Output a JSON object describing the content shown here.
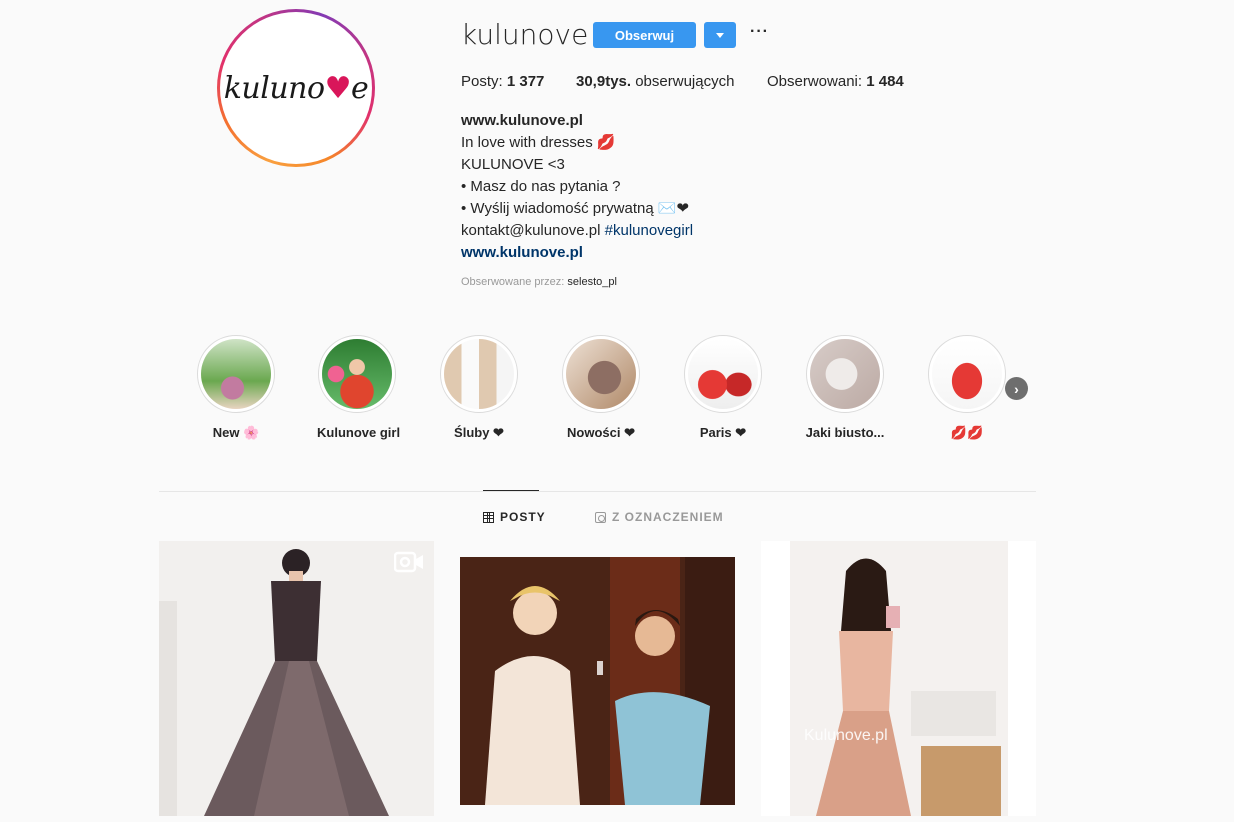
{
  "profile": {
    "username": "kulunove",
    "avatar_logo": "kulunove",
    "follow_label": "Obserwuj",
    "more_icon": "more-dots-icon"
  },
  "stats": {
    "posts_label": "Posty:",
    "posts_value": "1 377",
    "followers_value": "30,9tys.",
    "followers_label": "obserwujących",
    "following_label": "Obserwowani:",
    "following_value": "1 484"
  },
  "bio": {
    "lines": [
      "www.kulunove.pl",
      "In love with dresses 💋",
      "KULUNOVE <3",
      "• Masz do nas pytania ?",
      "• Wyślij wiadomość prywatną ✉️❤",
      "kontakt@kulunove.pl",
      "#kulunovegirl",
      "www.kulunove.pl"
    ],
    "followed_by_label": "Obserwowane przez:",
    "followed_by_user": "selesto_pl"
  },
  "highlights": [
    {
      "label": "New 🌸",
      "colors": [
        "#6aa84f",
        "#c27ba0",
        "#e8d4c0"
      ]
    },
    {
      "label": "Kulunove girl",
      "colors": [
        "#e0452e",
        "#2e7d32",
        "#f06292"
      ]
    },
    {
      "label": "Śluby ❤",
      "colors": [
        "#f5f5f5",
        "#64b5f6",
        "#e0c9b0"
      ]
    },
    {
      "label": "Nowości ❤",
      "colors": [
        "#b08968",
        "#8d6e63",
        "#ede0d4"
      ]
    },
    {
      "label": "Paris ❤",
      "colors": [
        "#e53935",
        "#f5f5f5",
        "#c62828"
      ]
    },
    {
      "label": "Jaki biusto...",
      "colors": [
        "#d7ccc8",
        "#efebe9",
        "#bcaaa4"
      ]
    },
    {
      "label": "💋💋",
      "colors": [
        "#e53935",
        "#f5f5f5",
        "#b71c1c"
      ]
    }
  ],
  "tabs": [
    {
      "label": "POSTY",
      "icon": "grid-icon",
      "active": true
    },
    {
      "label": "Z OZNACZENIEM",
      "icon": "tag-icon",
      "active": false
    }
  ],
  "posts": [
    {
      "kind": "video",
      "colors": [
        "#f2f0ee",
        "#6b5a5d",
        "#3d2f33"
      ]
    },
    {
      "kind": "photo",
      "colors": [
        "#3b1c12",
        "#8fc3d6",
        "#f3e5d8"
      ]
    },
    {
      "kind": "photo",
      "colors": [
        "#ffffff",
        "#e8b6a0",
        "#d9a088"
      ],
      "watermark": "Kulunove.pl"
    }
  ],
  "colors": {
    "accent": "#3897f0",
    "text": "#262626",
    "muted": "#999999",
    "link": "#003569"
  }
}
